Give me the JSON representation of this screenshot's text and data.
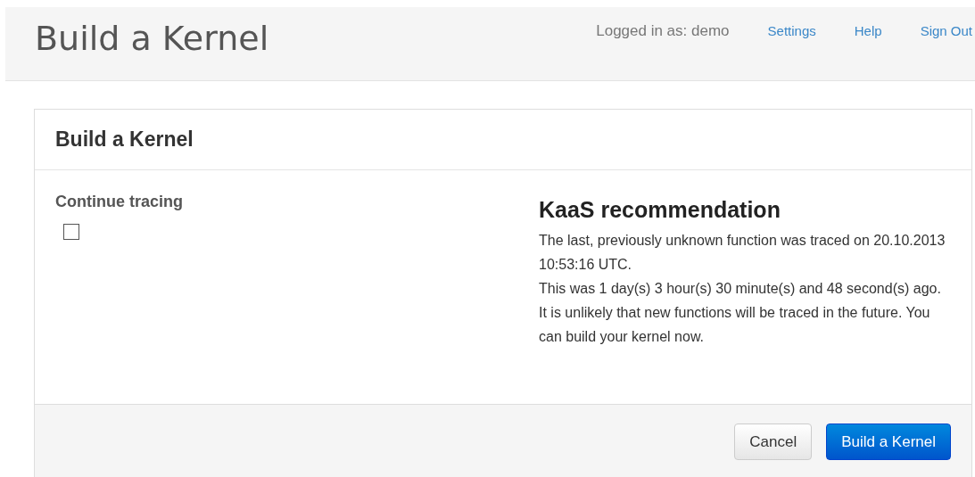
{
  "header": {
    "title": "Build a Kernel",
    "user_label": "Logged in as: demo",
    "links": [
      "Settings",
      "Help",
      "Sign Out"
    ]
  },
  "panel": {
    "title": "Build a Kernel",
    "option": {
      "label": "Continue tracing",
      "checked": false
    },
    "recommendation": {
      "title": "KaaS recommendation",
      "paragraphs": [
        "The last, previously unknown function was traced on 20.10.2013 10:53:16 UTC.",
        "This was 1 day(s) 3 hour(s) 30 minute(s) and 48 second(s) ago.",
        "It is unlikely that new functions will be traced in the future. You can build your kernel now."
      ]
    },
    "buttons": [
      {
        "label": "Cancel",
        "kind": "default"
      },
      {
        "label": "Build a Kernel",
        "kind": "primary"
      }
    ]
  }
}
